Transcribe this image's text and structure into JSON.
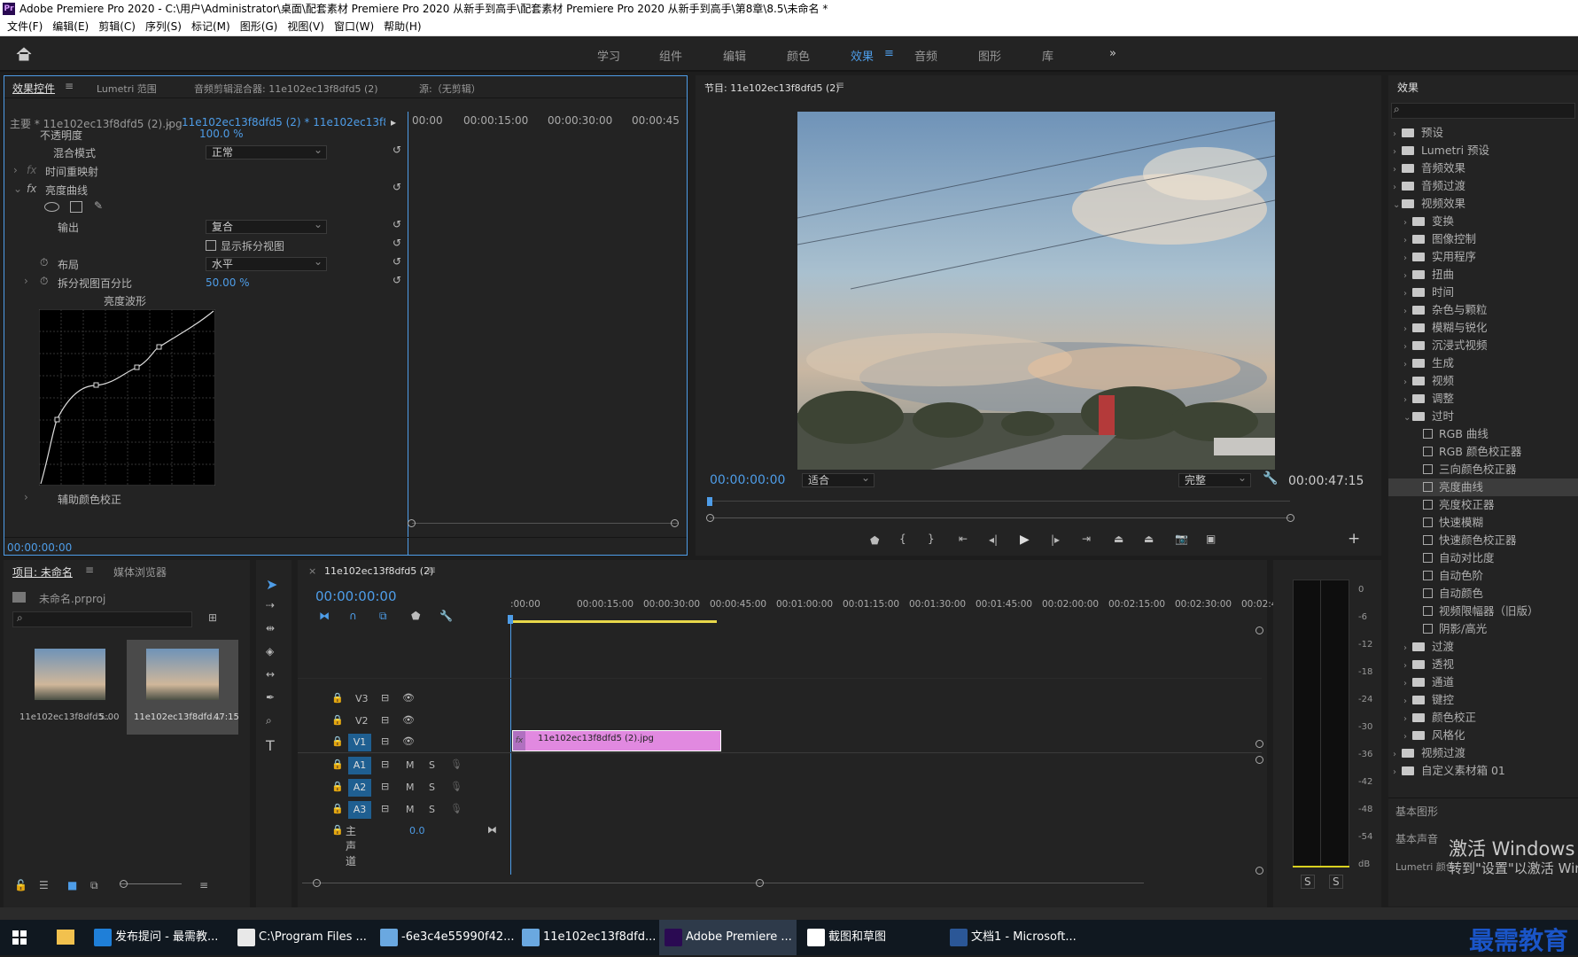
{
  "app": {
    "title": "Adobe Premiere Pro 2020 - C:\\用户\\Administrator\\桌面\\配套素材 Premiere Pro 2020 从新手到高手\\配套素材 Premiere Pro 2020 从新手到高手\\第8章\\8.5\\未命名 *",
    "logo": "Pr"
  },
  "menu": [
    "文件(F)",
    "编辑(E)",
    "剪辑(C)",
    "序列(S)",
    "标记(M)",
    "图形(G)",
    "视图(V)",
    "窗口(W)",
    "帮助(H)"
  ],
  "workspaces": [
    "学习",
    "组件",
    "编辑",
    "颜色",
    "效果",
    "音频",
    "图形",
    "库"
  ],
  "effect_controls": {
    "tabs": [
      "效果控件",
      "Lumetri 范围",
      "音频剪辑混合器: 11e102ec13f8dfd5 (2)",
      "源:（无剪辑）"
    ],
    "master": "主要 * 11e102ec13f8dfd5 (2).jpg",
    "clip": "11e102ec13f8dfd5 (2) * 11e102ec13f8dfd5 (...",
    "ruler": [
      "00:00",
      "00:00:15:00",
      "00:00:30:00",
      "00:00:45"
    ],
    "opacity_label": "不透明度",
    "opacity_value": "100.0 %",
    "blend_label": "混合模式",
    "blend_value": "正常",
    "time_remap": "时间重映射",
    "curves": "亮度曲线",
    "output_label": "输出",
    "output_value": "复合",
    "split_label": "显示拆分视图",
    "layout_label": "布局",
    "layout_value": "水平",
    "split_pct_label": "拆分视图百分比",
    "split_pct_value": "50.00 %",
    "waveform_label": "亮度波形",
    "secondary": "辅助颜色校正",
    "timecode": "00:00:00:00"
  },
  "program": {
    "title": "节目: 11e102ec13f8dfd5 (2)",
    "timecode": "00:00:00:00",
    "fit": "适合",
    "quality": "完整",
    "duration": "00:00:47:15"
  },
  "project": {
    "tabs": [
      "项目: 未命名",
      "媒体浏览器"
    ],
    "file": "未命名.prproj",
    "items": [
      {
        "name": "11e102ec13f8dfd5...",
        "dur": "5:00"
      },
      {
        "name": "11e102ec13f8dfd...",
        "dur": "47:15"
      }
    ]
  },
  "timeline": {
    "tab": "11e102ec13f8dfd5 (2)",
    "timecode": "00:00:00:00",
    "ruler": [
      ":00:00",
      "00:00:15:00",
      "00:00:30:00",
      "00:00:45:00",
      "00:01:00:00",
      "00:01:15:00",
      "00:01:30:00",
      "00:01:45:00",
      "00:02:00:00",
      "00:02:15:00",
      "00:02:30:00",
      "00:02:45:"
    ],
    "video_tracks": [
      "V3",
      "V2",
      "V1"
    ],
    "audio_tracks": [
      "A1",
      "A2",
      "A3"
    ],
    "master": "主声道",
    "master_val": "0.0",
    "clip": "11e102ec13f8dfd5 (2).jpg",
    "clip_fx": "fx",
    "m": "M",
    "s": "S"
  },
  "meter": {
    "ticks": [
      "0",
      "-6",
      "-12",
      "-18",
      "-24",
      "-30",
      "-36",
      "-42",
      "-48",
      "-54",
      "dB"
    ],
    "solo": [
      "S",
      "S"
    ]
  },
  "effects": {
    "title": "效果",
    "tree": [
      {
        "label": "预设",
        "level": 0,
        "type": "folder"
      },
      {
        "label": "Lumetri 预设",
        "level": 0,
        "type": "folder"
      },
      {
        "label": "音频效果",
        "level": 0,
        "type": "folder"
      },
      {
        "label": "音频过渡",
        "level": 0,
        "type": "folder"
      },
      {
        "label": "视频效果",
        "level": 0,
        "type": "folder",
        "open": true
      },
      {
        "label": "变换",
        "level": 1,
        "type": "folder"
      },
      {
        "label": "图像控制",
        "level": 1,
        "type": "folder"
      },
      {
        "label": "实用程序",
        "level": 1,
        "type": "folder"
      },
      {
        "label": "扭曲",
        "level": 1,
        "type": "folder"
      },
      {
        "label": "时间",
        "level": 1,
        "type": "folder"
      },
      {
        "label": "杂色与颗粒",
        "level": 1,
        "type": "folder"
      },
      {
        "label": "模糊与锐化",
        "level": 1,
        "type": "folder"
      },
      {
        "label": "沉浸式视频",
        "level": 1,
        "type": "folder"
      },
      {
        "label": "生成",
        "level": 1,
        "type": "folder"
      },
      {
        "label": "视频",
        "level": 1,
        "type": "folder"
      },
      {
        "label": "调整",
        "level": 1,
        "type": "folder"
      },
      {
        "label": "过时",
        "level": 1,
        "type": "folder",
        "open": true
      },
      {
        "label": "RGB 曲线",
        "level": 2,
        "type": "fx"
      },
      {
        "label": "RGB 颜色校正器",
        "level": 2,
        "type": "fx"
      },
      {
        "label": "三向颜色校正器",
        "level": 2,
        "type": "fx"
      },
      {
        "label": "亮度曲线",
        "level": 2,
        "type": "fx",
        "selected": true
      },
      {
        "label": "亮度校正器",
        "level": 2,
        "type": "fx"
      },
      {
        "label": "快速模糊",
        "level": 2,
        "type": "fx"
      },
      {
        "label": "快速颜色校正器",
        "level": 2,
        "type": "fx"
      },
      {
        "label": "自动对比度",
        "level": 2,
        "type": "fx"
      },
      {
        "label": "自动色阶",
        "level": 2,
        "type": "fx"
      },
      {
        "label": "自动颜色",
        "level": 2,
        "type": "fx"
      },
      {
        "label": "视频限幅器（旧版）",
        "level": 2,
        "type": "fx"
      },
      {
        "label": "阴影/高光",
        "level": 2,
        "type": "fx"
      },
      {
        "label": "过渡",
        "level": 1,
        "type": "folder"
      },
      {
        "label": "透视",
        "level": 1,
        "type": "folder"
      },
      {
        "label": "通道",
        "level": 1,
        "type": "folder"
      },
      {
        "label": "键控",
        "level": 1,
        "type": "folder"
      },
      {
        "label": "颜色校正",
        "level": 1,
        "type": "folder"
      },
      {
        "label": "风格化",
        "level": 1,
        "type": "folder"
      },
      {
        "label": "视频过渡",
        "level": 0,
        "type": "folder"
      },
      {
        "label": "自定义素材箱 01",
        "level": 0,
        "type": "folder"
      }
    ],
    "bottom": [
      "基本图形",
      "基本声音",
      "Lumetri 颜色"
    ]
  },
  "watermark": {
    "line1": "激活 Windows",
    "line2": "转到\"设置\"以激活 Win",
    "brand": "最需教育"
  },
  "taskbar": [
    {
      "label": "发布提问 - 最需教...",
      "color": "#1f7fd8"
    },
    {
      "label": "C:\\Program Files ...",
      "color": "#e8e8e8"
    },
    {
      "label": "-6e3c4e55990f42...",
      "color": "#6aa8e0"
    },
    {
      "label": "11e102ec13f8dfd...",
      "color": "#6aa8e0"
    },
    {
      "label": "Adobe Premiere ...",
      "color": "#2a0a52",
      "active": true
    },
    {
      "label": "截图和草图",
      "color": "#ffffff"
    },
    {
      "label": "文档1 - Microsoft...",
      "color": "#2b5797"
    }
  ]
}
